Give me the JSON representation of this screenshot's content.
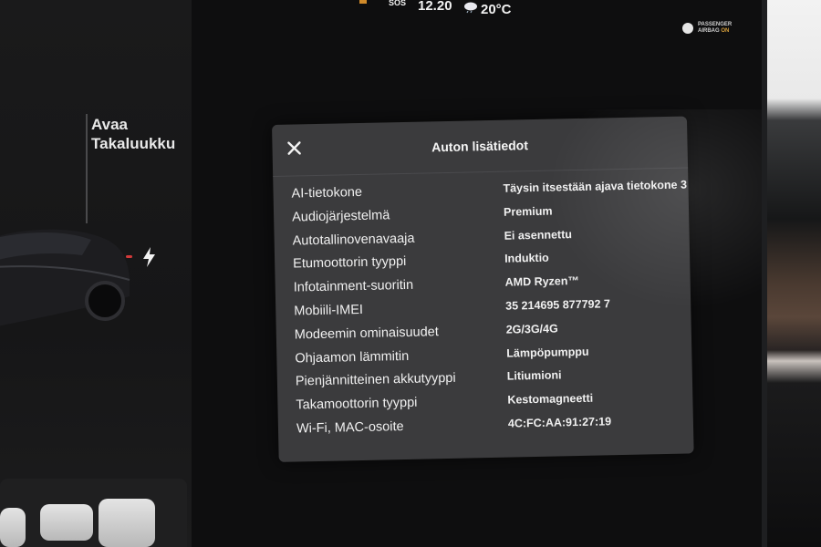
{
  "status_bar": {
    "sos_label": "SOS",
    "time": "12.20",
    "temperature": "20°C",
    "weather_icon": "cloud-rain-icon"
  },
  "airbag": {
    "line1": "PASSENGER",
    "line2_prefix": "AIRBAG",
    "line2_state": "ON",
    "state_color": "#d9a13c"
  },
  "left_panel": {
    "trunk_line1": "Avaa",
    "trunk_line2": "Takaluukku",
    "charge_icon": "lightning-icon",
    "charge_port_color": "#d23a3a"
  },
  "modal": {
    "title": "Auton lisätiedot",
    "close_icon": "close-icon",
    "rows": [
      {
        "label": "AI-tietokone",
        "value": "Täysin itsestään ajava tietokone 3"
      },
      {
        "label": "Audiojärjestelmä",
        "value": "Premium"
      },
      {
        "label": "Autotallinovenavaaja",
        "value": "Ei asennettu"
      },
      {
        "label": "Etumoottorin tyyppi",
        "value": "Induktio"
      },
      {
        "label": "Infotainment-suoritin",
        "value": "AMD Ryzen™"
      },
      {
        "label": "Mobiili-IMEI",
        "value": "35 214695 877792 7"
      },
      {
        "label": "Modeemin ominaisuudet",
        "value": "2G/3G/4G"
      },
      {
        "label": "Ohjaamon lämmitin",
        "value": "Lämpöpumppu"
      },
      {
        "label": "Pienjännitteinen akkutyyppi",
        "value": "Litiumioni"
      },
      {
        "label": "Takamoottorin tyyppi",
        "value": "Kestomagneetti"
      },
      {
        "label": "Wi-Fi, MAC-osoite",
        "value": "4C:FC:AA:91:27:19"
      }
    ]
  },
  "colors": {
    "modal_background": "#3b3b3d",
    "text": "#f0f0f0"
  }
}
